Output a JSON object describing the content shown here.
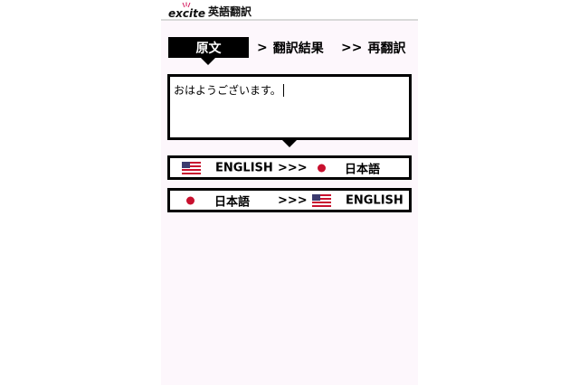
{
  "header": {
    "logo_text": "excite",
    "title": "英語翻訳"
  },
  "tabs": {
    "original": "原文",
    "result": "翻訳結果",
    "retranslate": "再翻訳",
    "chevron_single": ">",
    "chevron_double": ">>"
  },
  "input": {
    "value": "おはようございます。"
  },
  "buttons": {
    "en_to_ja": {
      "from": "ENGLISH",
      "arrows": ">>>",
      "to": "日本語"
    },
    "ja_to_en": {
      "from": "日本語",
      "arrows": ">>>",
      "to": "ENGLISH"
    }
  },
  "colors": {
    "accent": "#000000",
    "background": "#fdf7fc",
    "flag_red": "#c8102e",
    "flag_blue": "#3c3b6e"
  }
}
